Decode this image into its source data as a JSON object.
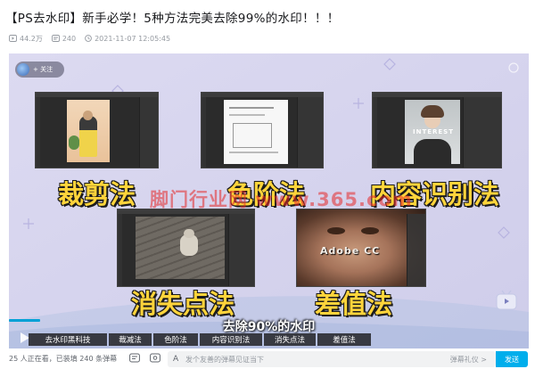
{
  "video": {
    "title": "【PS去水印】新手必学！5种方法完美去除99%的水印！！！",
    "views": "44.2万",
    "danmaku_count": "240",
    "date": "2021-11-07 12:05:45"
  },
  "player": {
    "follow_label": "+ 关注",
    "labels": {
      "crop": "裁剪法",
      "levels": "色阶法",
      "content_aware": "内容识别法",
      "vanishing_point": "消失点法",
      "difference": "差值法"
    },
    "overlay_text": {
      "adobe": "Adobe CC",
      "magazine": "INTEREST"
    },
    "watermark": "脚门行业网 www.365.com",
    "subtitle": "去除90%的水印",
    "progress": 0.06,
    "chapters": [
      "去水印黑科技",
      "裁减法",
      "色阶法",
      "内容识别法",
      "消失点法",
      "差值法"
    ]
  },
  "bottom_bar": {
    "viewers": "25 人正在看，已装填 240 条弹幕",
    "danmaku_placeholder": "发个友善的弹幕见证当下",
    "etiquette": "弹幕礼仪 >",
    "send": "发送"
  },
  "colors": {
    "accent": "#00aeec",
    "label_yellow": "#ffd43b",
    "progress": "#00a1d6"
  }
}
